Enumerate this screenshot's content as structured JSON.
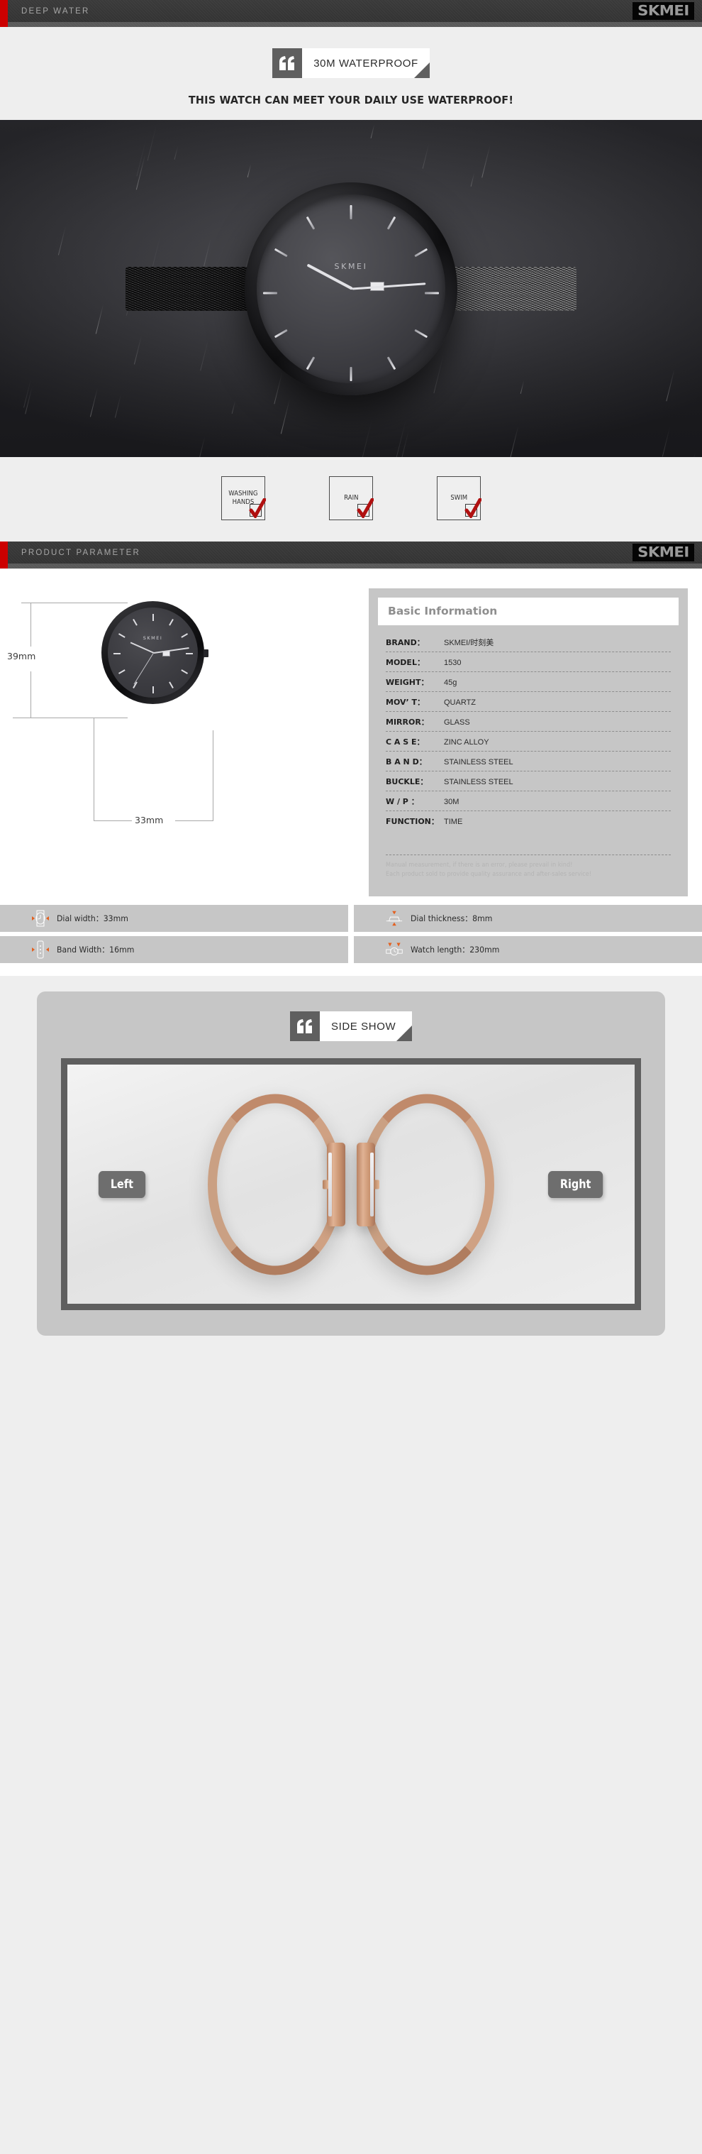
{
  "header": {
    "title": "DEEP WATER",
    "logo": "SKMEI"
  },
  "waterproof": {
    "banner_label": "30M WATERPROOF",
    "quote_icon": "quote-mark-icon",
    "tagline": "THIS WATCH CAN MEET YOUR DAILY USE WATERPROOF!",
    "checks": [
      {
        "label": "WASHING HANDS",
        "line1": "WASHING",
        "line2": "HANDS",
        "checked": true
      },
      {
        "label": "RAIN",
        "line1": "RAIN",
        "line2": "",
        "checked": true
      },
      {
        "label": "SWIM",
        "line1": "SWIM",
        "line2": "",
        "checked": true
      }
    ],
    "check_color": "#b01010"
  },
  "product_parameter": {
    "section_title": "PRODUCT PARAMETER",
    "logo": "SKMEI",
    "dimensions": {
      "height_label": "39mm",
      "width_label": "33mm"
    },
    "basic_information": {
      "title": "Basic Information",
      "rows": [
        {
          "key": "BRAND：",
          "value": "SKMEI/时刻美"
        },
        {
          "key": "MODEL：",
          "value": "1530"
        },
        {
          "key": "WEIGHT：",
          "value": "45g"
        },
        {
          "key": "MOV’ T：",
          "value": "QUARTZ"
        },
        {
          "key": "MIRROR：",
          "value": "GLASS"
        },
        {
          "key": "C A S E：",
          "value": "ZINC ALLOY"
        },
        {
          "key": "B A N D：",
          "value": "STAINLESS STEEL"
        },
        {
          "key": "BUCKLE：",
          "value": "STAINLESS STEEL"
        },
        {
          "key": "W / P  ：",
          "value": "30M"
        },
        {
          "key": "FUNCTION：",
          "value": "TIME"
        }
      ],
      "note_line1": "Manual measurement, if there is an error, please prevail in kind!",
      "note_line2": "Each product sold to provide quality assurance and after-sales service!"
    },
    "specs": [
      {
        "icon": "dial-width-icon",
        "text": "Dial width：33mm"
      },
      {
        "icon": "dial-thickness-icon",
        "text": "Dial thickness：8mm"
      },
      {
        "icon": "band-width-icon",
        "text": "Band Width：16mm"
      },
      {
        "icon": "watch-length-icon",
        "text": "Watch length：230mm"
      }
    ],
    "spec_accent_color": "#e4601f"
  },
  "side_show": {
    "banner_label": "SIDE SHOW",
    "quote_icon": "quote-mark-icon",
    "left_label": "Left",
    "right_label": "Right"
  }
}
